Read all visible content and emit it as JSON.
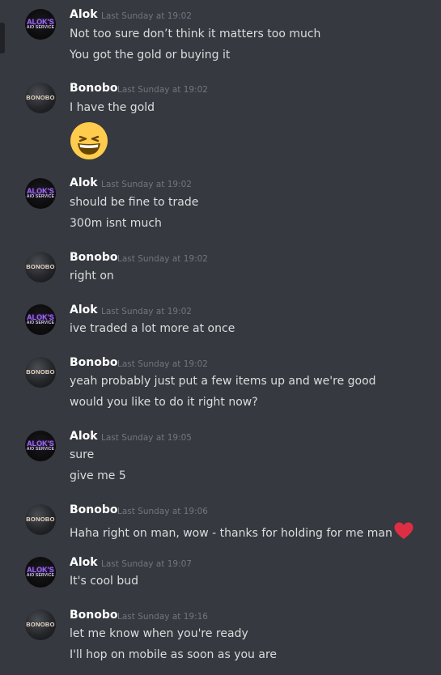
{
  "channel": {
    "messages": [
      {
        "author": "Alok",
        "timestamp": "Last Sunday at 19:02",
        "lines": [
          "Not too sure don’t think it matters too much",
          "You got the gold or buying it"
        ]
      },
      {
        "author": "Bonobo",
        "timestamp": "Last Sunday at 19:02",
        "lines": [
          "I have the gold"
        ],
        "emoji": "grinning-squinting-face-emoji"
      },
      {
        "author": "Alok",
        "timestamp": "Last Sunday at 19:02",
        "lines": [
          "should be fine to trade",
          "300m isnt much"
        ]
      },
      {
        "author": "Bonobo",
        "timestamp": "Last Sunday at 19:02",
        "lines": [
          "right on"
        ]
      },
      {
        "author": "Alok",
        "timestamp": "Last Sunday at 19:02",
        "lines": [
          "ive traded a lot more at once"
        ]
      },
      {
        "author": "Bonobo",
        "timestamp": "Last Sunday at 19:02",
        "lines": [
          "yeah probably just put a few items up and we're good",
          "would you like to do it right now?"
        ]
      },
      {
        "author": "Alok",
        "timestamp": "Last Sunday at 19:05",
        "lines": [
          "sure",
          "give me 5"
        ]
      },
      {
        "author": "Bonobo",
        "timestamp": "Last Sunday at 19:06",
        "lines": [
          "Haha right on man, wow - thanks for holding for me man"
        ],
        "emoji": "red-heart-emoji"
      },
      {
        "author": "Alok",
        "timestamp": "Last Sunday at 19:07",
        "lines": [
          "It's cool bud"
        ]
      },
      {
        "author": "Bonobo",
        "timestamp": "Last Sunday at 19:16",
        "lines": [
          "let me know when you're ready",
          "I'll hop on mobile as soon as you are"
        ]
      }
    ]
  },
  "avatars": {
    "alok": {
      "line1": "ALOK'S",
      "line2": "AIO SERVICE"
    },
    "bonobo": {
      "line1": "BONOBO"
    }
  },
  "colors": {
    "background": "#36393f",
    "username": "#ffffff",
    "timestamp": "#72767d",
    "message_text": "#dcddde",
    "alok_avatar_accent": "#a06bf0",
    "heart": "#dd2e44"
  }
}
